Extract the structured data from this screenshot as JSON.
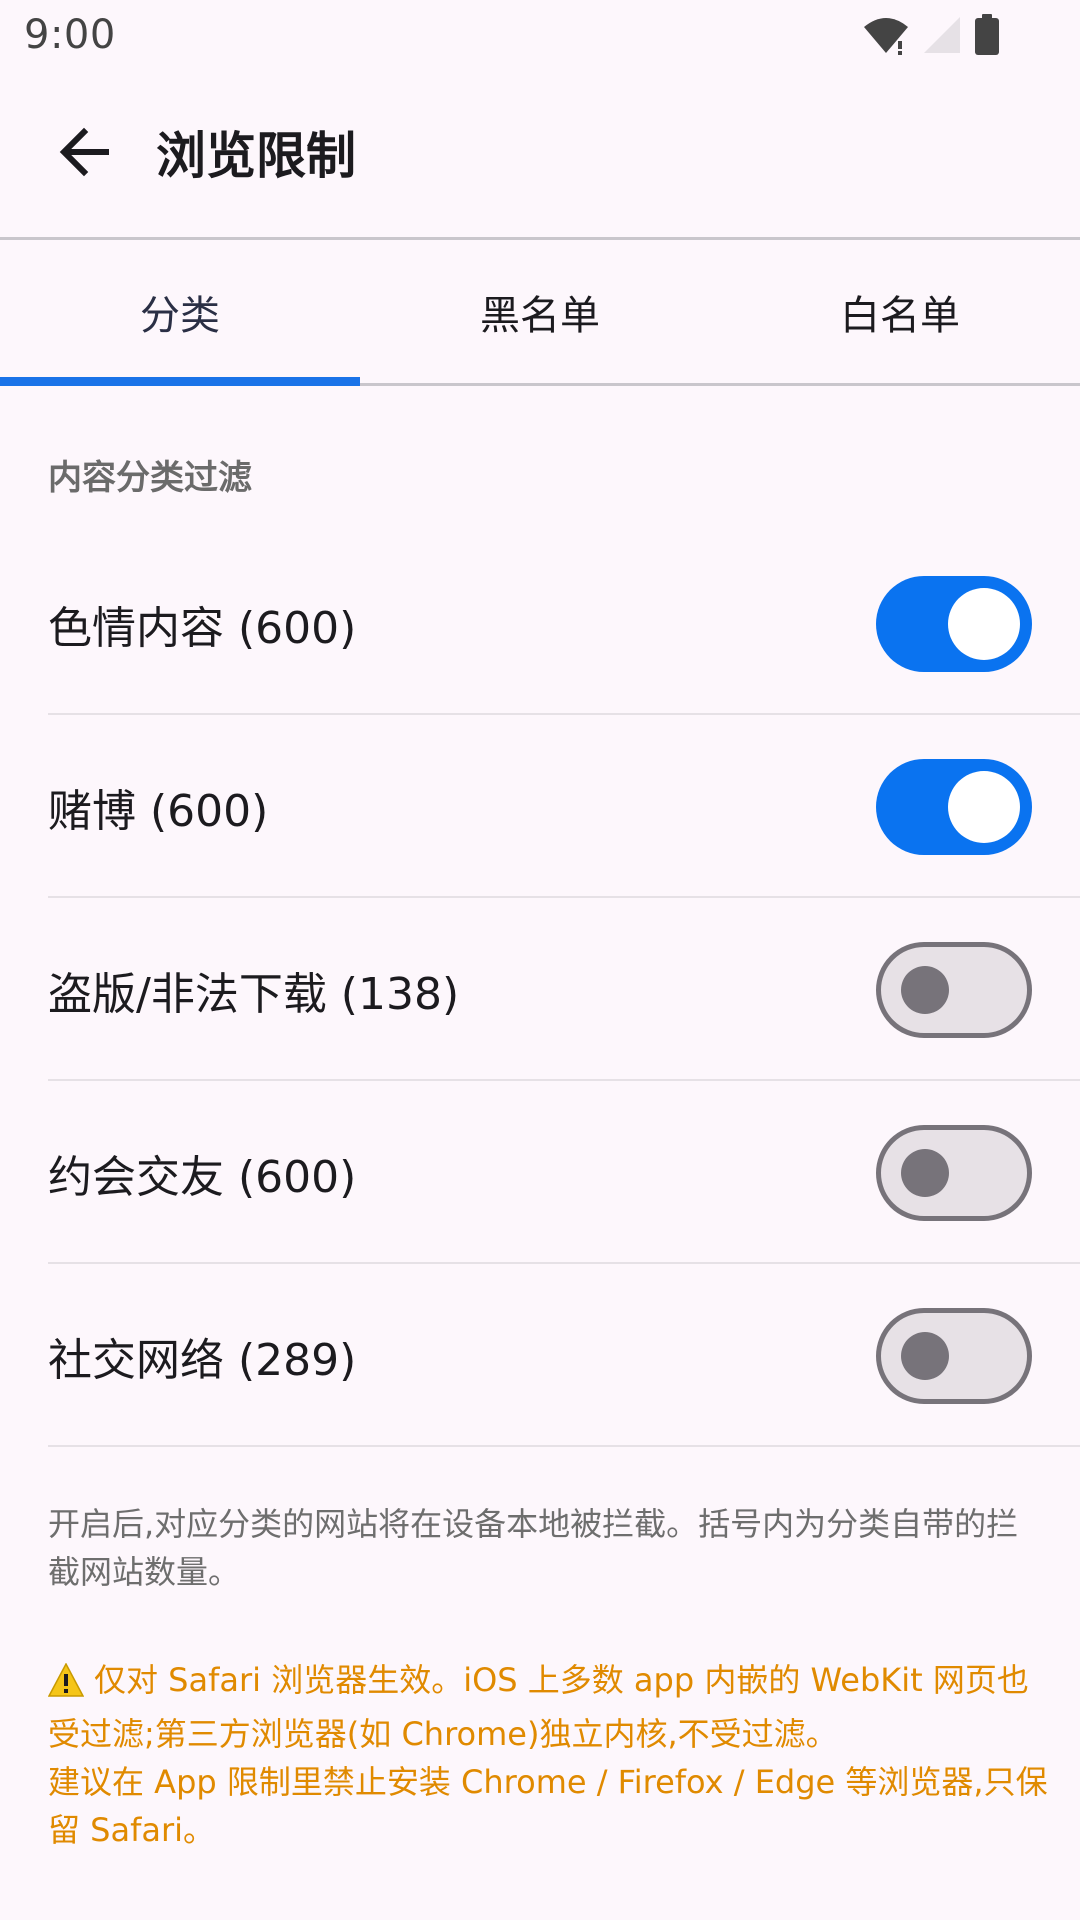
{
  "status_bar": {
    "time": "9:00",
    "icons": [
      "wifi-icon",
      "cellular-icon",
      "battery-icon"
    ]
  },
  "app_bar": {
    "back_icon": "arrow-back-icon",
    "title": "浏览限制"
  },
  "tabs": [
    {
      "label": "分类",
      "active": true
    },
    {
      "label": "黑名单",
      "active": false
    },
    {
      "label": "白名单",
      "active": false
    }
  ],
  "section_header": "内容分类过滤",
  "categories": [
    {
      "label": "色情内容 (600)",
      "enabled": true
    },
    {
      "label": "赌博 (600)",
      "enabled": true
    },
    {
      "label": "盗版/非法下载 (138)",
      "enabled": false
    },
    {
      "label": "约会交友 (600)",
      "enabled": false
    },
    {
      "label": "社交网络 (289)",
      "enabled": false
    }
  ],
  "description": "开启后,对应分类的网站将在设备本地被拦截。括号内为分类自带的拦截网站数量。",
  "warning": {
    "icon": "warning-icon",
    "line1": "仅对 Safari 浏览器生效。iOS 上多数 app 内嵌的 WebKit 网页也受过滤;第三方浏览器(如 Chrome)独立内核,不受过滤。",
    "line2": "建议在 App 限制里禁止安装 Chrome / Firefox / Edge 等浏览器,只保留 Safari。"
  },
  "colors": {
    "accent": "#0a73f0",
    "warning": "#e08a00",
    "background": "#fdf7fc"
  }
}
